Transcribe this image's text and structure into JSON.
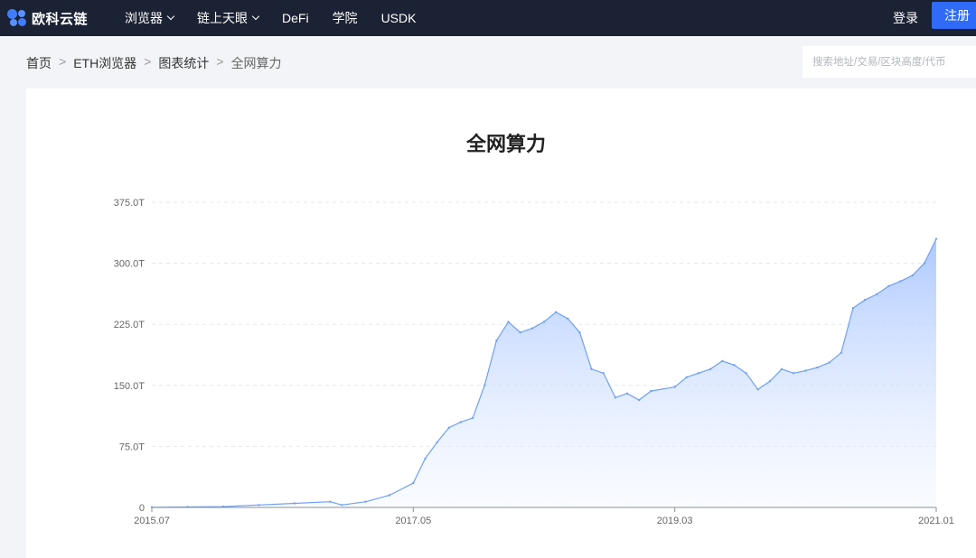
{
  "nav": {
    "brand": "欧科云链",
    "items": [
      {
        "label": "浏览器",
        "dropdown": true
      },
      {
        "label": "链上天眼",
        "dropdown": true
      },
      {
        "label": "DeFi",
        "dropdown": false
      },
      {
        "label": "学院",
        "dropdown": false
      },
      {
        "label": "USDK",
        "dropdown": false
      }
    ],
    "login": "登录",
    "register": "注册"
  },
  "breadcrumb": [
    "首页",
    "ETH浏览器",
    "图表统计",
    "全网算力"
  ],
  "breadcrumb_separator": ">",
  "search": {
    "placeholder": "搜索地址/交易/区块高度/代币"
  },
  "colors": {
    "nav_bg": "#1b2233",
    "accent": "#2f6bf6",
    "line": "#6ea0f5",
    "area_top": "#a9c6ff"
  },
  "chart_data": {
    "type": "area",
    "title": "全网算力",
    "xlabel": "",
    "ylabel": "",
    "x_ticks": [
      "2015.07",
      "2017.05",
      "2019.03",
      "2021.01"
    ],
    "y_ticks": [
      "0",
      "75.0T",
      "150.0T",
      "225.0T",
      "300.0T",
      "375.0T"
    ],
    "ylim": [
      0,
      375
    ],
    "grid": true,
    "legend": "none",
    "unit": "T",
    "series": [
      {
        "x": [
          "2015.07",
          "2015.10",
          "2016.01",
          "2016.04",
          "2016.07",
          "2016.10",
          "2016.11",
          "2017.01",
          "2017.03",
          "2017.05",
          "2017.06",
          "2017.07",
          "2017.08",
          "2017.09",
          "2017.10",
          "2017.11",
          "2017.12",
          "2018.01",
          "2018.02",
          "2018.03",
          "2018.04",
          "2018.05",
          "2018.06",
          "2018.07",
          "2018.08",
          "2018.09",
          "2018.10",
          "2018.11",
          "2018.12",
          "2019.01",
          "2019.03",
          "2019.04",
          "2019.05",
          "2019.06",
          "2019.07",
          "2019.08",
          "2019.09",
          "2019.10",
          "2019.11",
          "2019.12",
          "2020.01",
          "2020.02",
          "2020.03",
          "2020.04",
          "2020.05",
          "2020.06",
          "2020.07",
          "2020.08",
          "2020.09",
          "2020.10",
          "2020.11",
          "2020.12",
          "2021.01"
        ],
        "values": [
          0.2,
          0.5,
          1,
          3,
          5,
          7,
          3,
          7,
          15,
          30,
          60,
          80,
          98,
          105,
          110,
          150,
          205,
          228,
          215,
          220,
          228,
          240,
          232,
          215,
          170,
          165,
          135,
          140,
          132,
          143,
          148,
          160,
          165,
          170,
          180,
          175,
          165,
          145,
          155,
          170,
          165,
          168,
          172,
          178,
          190,
          245,
          255,
          262,
          272,
          278,
          285,
          300,
          330
        ]
      }
    ]
  }
}
